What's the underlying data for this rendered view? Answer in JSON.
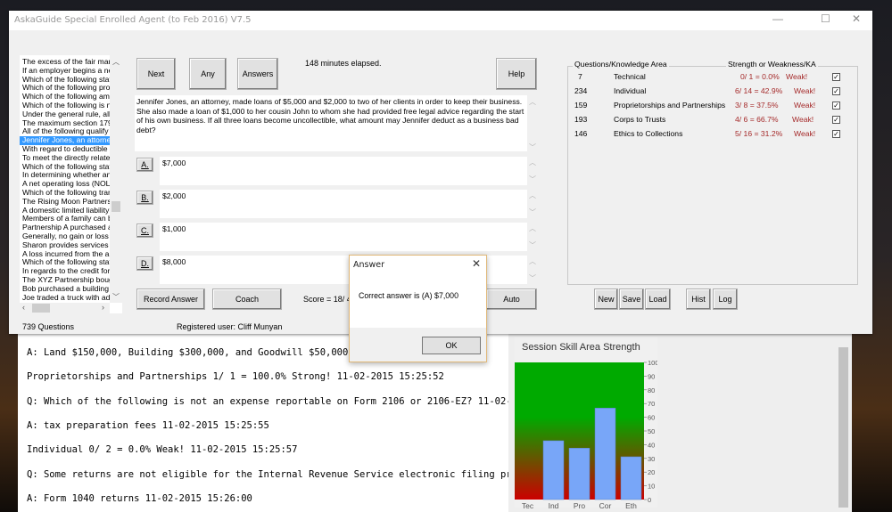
{
  "main_window": {
    "title": "AskaGuide Special Enrolled Agent (to Feb 2016)  V7.5",
    "controls": {
      "minimize": "—",
      "maximize": "☐",
      "close": "✕"
    }
  },
  "question_list": {
    "items": [
      "The excess of the fair market",
      "If an employer begins a new",
      "Which of the following state",
      "Which of the following prope",
      "Which of the following amou",
      "Which of the following is no",
      "Under the general rule, all o",
      "The maximum section 179 e",
      "All of the following qualify fo",
      "Jennifer Jones, an attorney,",
      "With regard to deductible tra",
      "To meet the directly related",
      "Which of the following state",
      "In determining whether an a",
      "A net operating loss (NOL) r",
      "Which of the following trans",
      "The Rising Moon Partnershi",
      "A domestic limited liability co",
      "Members of a family can be",
      "Partnership A purchased a b",
      "Generally, no gain or loss is",
      "Sharon provides services to",
      "A loss incurred from the aba",
      "Which of the following state",
      "In regards to the credit for E",
      "The XYZ Partnership bough",
      "Bob purchased a building ar",
      "Joe traded a truck with adju"
    ],
    "selected_index": 9,
    "count_label": "739 Questions"
  },
  "toolbar": {
    "next": "Next",
    "any": "Any",
    "answers": "Answers",
    "help": "Help",
    "elapsed": "148 minutes elapsed."
  },
  "question": {
    "text": "Jennifer Jones, an attorney, made loans of $5,000 and $2,000 to two of her clients in order to keep their business. She also made a loan of $1,000 to her cousin John to whom she had provided free legal advice regarding the start of his own business. If all three loans become uncollectible, what amount may Jennifer deduct as a business bad debt?",
    "choices": [
      {
        "letter": "A.",
        "text": "$7,000"
      },
      {
        "letter": "B.",
        "text": "$2,000"
      },
      {
        "letter": "C.",
        "text": "$1,000"
      },
      {
        "letter": "D.",
        "text": "$8,000"
      }
    ]
  },
  "bottom_bar": {
    "record_answer": "Record Answer",
    "coach": "Coach",
    "score": "Score =  18/ 4",
    "auto": "Auto",
    "registered_user": "Registered user:  Cliff Munyan"
  },
  "knowledge_areas": {
    "header_left": "Questions/Knowledge Area",
    "header_right": "Strength or Weakness/KA",
    "weak_color": "#a52a2a",
    "rows": [
      {
        "count": "7",
        "name": "Technical",
        "score": "0/ 1 = 0.0%",
        "status": "Weak!",
        "checked": true
      },
      {
        "count": "234",
        "name": "Individual",
        "score": "6/ 14 = 42.9%",
        "status": "Weak!",
        "checked": true
      },
      {
        "count": "159",
        "name": "Proprietorships and Partnerships",
        "score": "3/ 8 = 37.5%",
        "status": "Weak!",
        "checked": true
      },
      {
        "count": "193",
        "name": "Corps to Trusts",
        "score": "4/ 6 = 66.7%",
        "status": "Weak!",
        "checked": true
      },
      {
        "count": "146",
        "name": "Ethics to Collections",
        "score": "5/ 16 = 31.2%",
        "status": "Weak!",
        "checked": true
      }
    ],
    "buttons": {
      "new": "New",
      "save": "Save",
      "load": "Load",
      "hist": "Hist",
      "log": "Log"
    }
  },
  "dialog": {
    "title": "Answer",
    "message": "Correct answer is  (A)  $7,000",
    "ok": "OK",
    "close": "✕"
  },
  "log_lines": [
    "A: Land $150,000, Building $300,000, and Goodwill $50,000 11-02-2015 15:25:50",
    "Proprietorships and Partnerships 1/ 1 = 100.0%   Strong! 11-02-2015 15:25:52",
    "Q: Which of the following is not an expense reportable on Form 2106 or 2106-EZ? 11-02-2015 15:25:53",
    "A: tax preparation fees 11-02-2015 15:25:55",
    "Individual 0/ 2 = 0.0%   Weak! 11-02-2015 15:25:57",
    "Q: Some returns are not eligible for the Internal Revenue Service electronic filing program",
    "A: Form 1040 returns 11-02-2015 15:26:00"
  ],
  "chart_data": {
    "type": "bar",
    "title": "Session Skill Area Strength",
    "categories": [
      "Tec",
      "Ind",
      "Pro",
      "Cor",
      "Eth"
    ],
    "values": [
      0,
      42.9,
      37.5,
      66.7,
      31.2
    ],
    "ylim": [
      0,
      100
    ],
    "yticks": [
      "0",
      "10",
      "20",
      "30",
      "40",
      "50",
      "60",
      "70",
      "80",
      "90",
      "100"
    ],
    "bar_color": "#78a6f8",
    "background_gradient": [
      "#00aa00",
      "#cc0000"
    ],
    "grid": false
  }
}
